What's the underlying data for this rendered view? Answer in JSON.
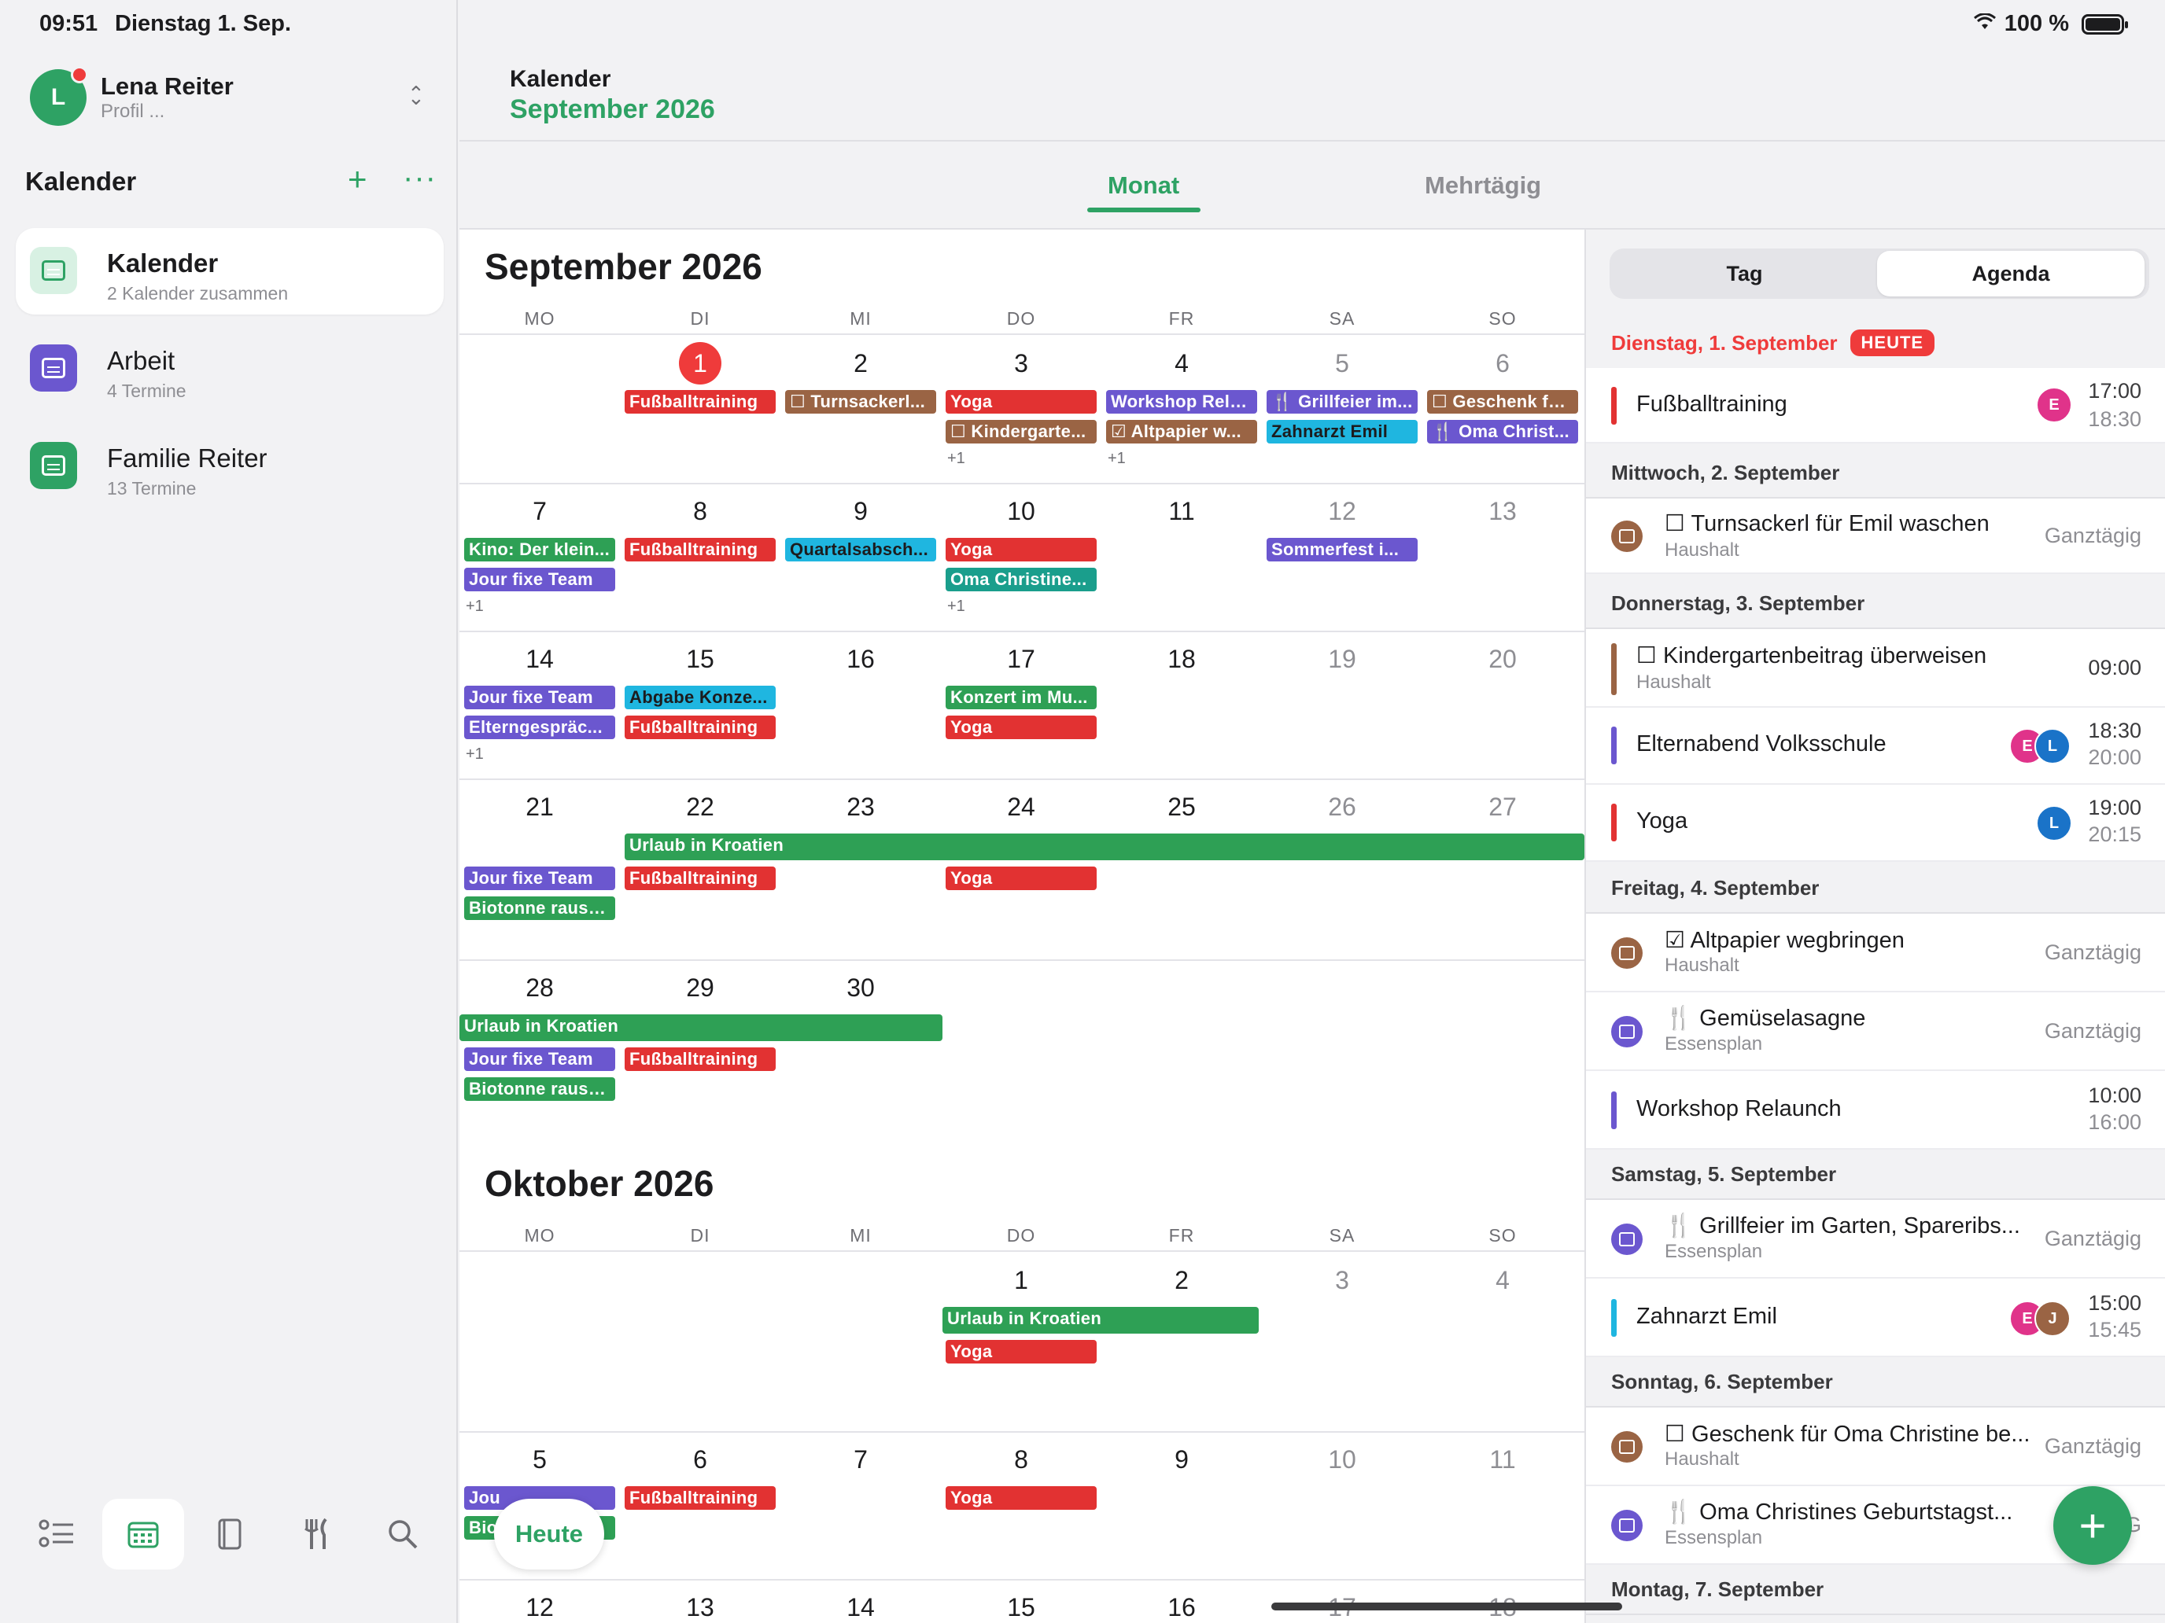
{
  "status": {
    "time": "09:51",
    "date": "Dienstag 1. Sep.",
    "battery": "100 %"
  },
  "profile": {
    "initial": "L",
    "name": "Lena Reiter",
    "sub": "Profil ..."
  },
  "sidebar": {
    "heading": "Kalender",
    "items": [
      {
        "title": "Kalender",
        "sub": "2 Kalender zusammen",
        "color": "#2ea264"
      },
      {
        "title": "Arbeit",
        "sub": "4 Termine",
        "color": "#6b57cf"
      },
      {
        "title": "Familie Reiter",
        "sub": "13 Termine",
        "color": "#2ea264"
      }
    ]
  },
  "header": {
    "app": "Kalender",
    "month": "September 2026"
  },
  "view_tabs": {
    "month": "Monat",
    "multi": "Mehrtägig"
  },
  "weekdays": [
    "MO",
    "DI",
    "MI",
    "DO",
    "FR",
    "SA",
    "SO"
  ],
  "months": {
    "sep": "September 2026",
    "oct": "Oktober 2026"
  },
  "sep_days": {
    "w1": [
      "",
      "1",
      "2",
      "3",
      "4",
      "5",
      "6"
    ],
    "w2": [
      "7",
      "8",
      "9",
      "10",
      "11",
      "12",
      "13"
    ],
    "w3": [
      "14",
      "15",
      "16",
      "17",
      "18",
      "19",
      "20"
    ],
    "w4": [
      "21",
      "22",
      "23",
      "24",
      "25",
      "26",
      "27"
    ],
    "w5": [
      "28",
      "29",
      "30"
    ]
  },
  "oct_days": {
    "w1": [
      "1",
      "2",
      "3",
      "4"
    ],
    "w2": [
      "5",
      "6",
      "7",
      "8",
      "9",
      "10",
      "11"
    ],
    "w3": [
      "12",
      "13",
      "14",
      "15",
      "16",
      "17",
      "18"
    ]
  },
  "events": {
    "fussball": "Fußballtraining",
    "turnsackerl": "☐ Turnsackerl...",
    "yoga": "Yoga",
    "kindergarten": "☐ Kindergarte...",
    "workshop": "Workshop Rela...",
    "altpapier": "☑ Altpapier w...",
    "grillfeier": "🍴 Grillfeier im...",
    "zahnarzt": "Zahnarzt Emil",
    "geschenk": "☐ Geschenk fü...",
    "oma": "🍴 Oma Christ...",
    "kino": "Kino: Der klein...",
    "jourfixe": "Jour fixe Team",
    "quartal": "Quartalsabsch...",
    "omachristine": "Oma Christine...",
    "sommerfest": "Sommerfest i...",
    "abgabe": "Abgabe Konze...",
    "eltern": "Elterngespräc...",
    "konzert": "Konzert im Mu...",
    "urlaub": "Urlaub in Kroatien",
    "biotonne": "Biotonne rauss...",
    "jou": "Jou",
    "bio": "Bio",
    "more": "+1"
  },
  "heute_button": "Heute",
  "agenda": {
    "tabs": {
      "day": "Tag",
      "agenda": "Agenda"
    },
    "today_badge": "HEUTE",
    "days": [
      {
        "label": "Dienstag, 1. September"
      },
      {
        "label": "Mittwoch, 2. September"
      },
      {
        "label": "Donnerstag, 3. September"
      },
      {
        "label": "Freitag, 4. September"
      },
      {
        "label": "Samstag, 5. September"
      },
      {
        "label": "Sonntag, 6. September"
      },
      {
        "label": "Montag, 7. September"
      }
    ],
    "entries": [
      {
        "title": "Fußballtraining",
        "t1": "17:00",
        "t2": "18:30",
        "av": [
          "E"
        ]
      },
      {
        "title": "☐ Turnsackerl für Emil waschen",
        "sub": "Haushalt",
        "all": "Ganztägig"
      },
      {
        "title": "☐ Kindergartenbeitrag überweisen",
        "sub": "Haushalt",
        "t1": "09:00"
      },
      {
        "title": "Elternabend Volksschule",
        "t1": "18:30",
        "t2": "20:00",
        "av": [
          "E",
          "L"
        ]
      },
      {
        "title": "Yoga",
        "t1": "19:00",
        "t2": "20:15",
        "av": [
          "L"
        ]
      },
      {
        "title": "☑ Altpapier wegbringen",
        "sub": "Haushalt",
        "all": "Ganztägig"
      },
      {
        "title": "🍴 Gemüselasagne",
        "sub": "Essensplan",
        "all": "Ganztägig"
      },
      {
        "title": "Workshop Relaunch",
        "t1": "10:00",
        "t2": "16:00"
      },
      {
        "title": "🍴 Grillfeier im Garten, Spareribs...",
        "sub": "Essensplan",
        "all": "Ganztägig"
      },
      {
        "title": "Zahnarzt Emil",
        "t1": "15:00",
        "t2": "15:45",
        "av": [
          "E",
          "J"
        ]
      },
      {
        "title": "☐ Geschenk für Oma Christine be...",
        "sub": "Haushalt",
        "all": "Ganztägig"
      },
      {
        "title": "🍴 Oma Christines Geburtstagst...",
        "sub": "Essensplan",
        "all": "G"
      }
    ]
  },
  "colors": {
    "accent": "#2ea264",
    "today": "#ef3b3b",
    "work": "#6b57cf",
    "household": "#9a6444"
  }
}
